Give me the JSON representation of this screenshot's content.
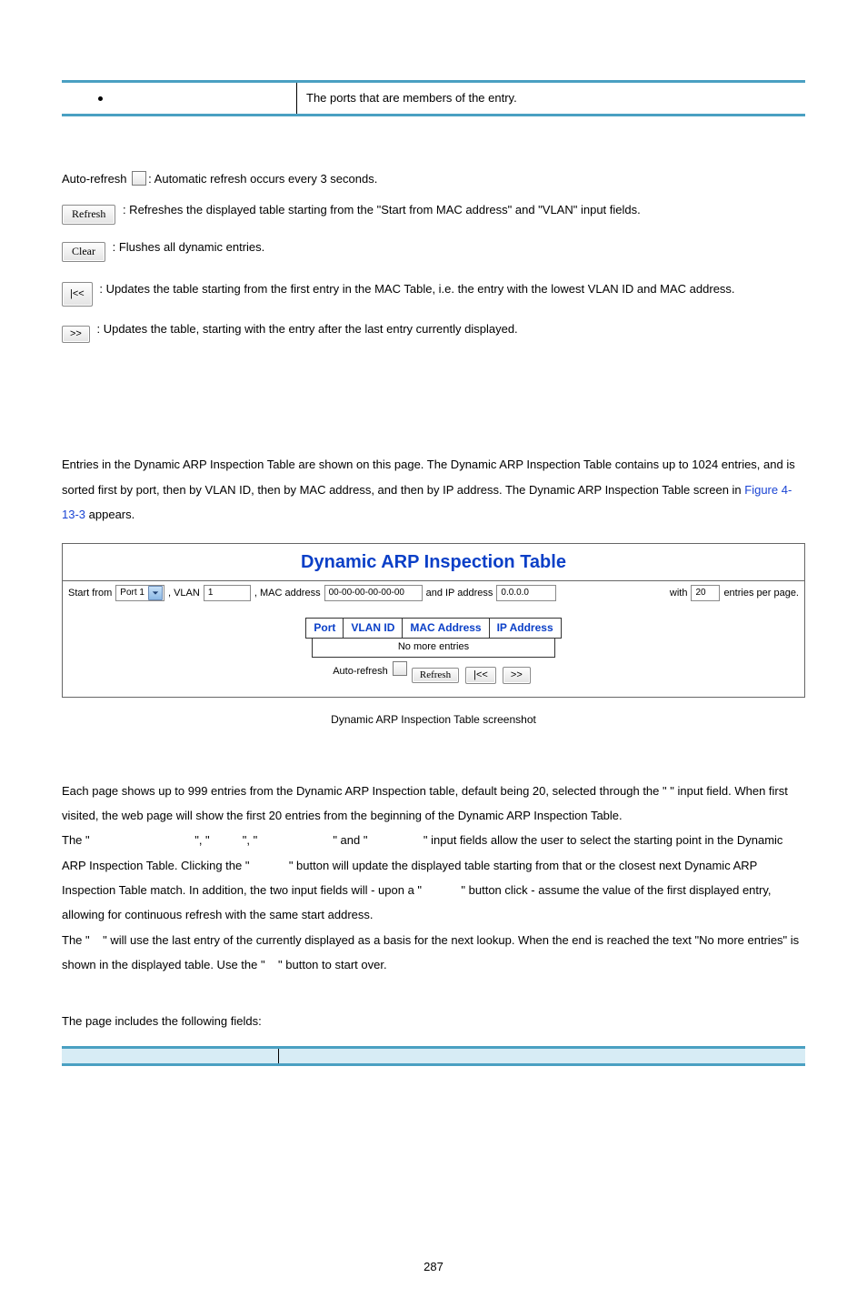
{
  "top_row": {
    "label": "",
    "desc": "The ports that are members of the entry."
  },
  "buttons": {
    "auto_refresh_prefix": "Auto-refresh ",
    "auto_refresh_suffix": ": Automatic refresh occurs every 3 seconds.",
    "refresh_label": "Refresh",
    "refresh_text": ": Refreshes the displayed table starting from the \"Start from MAC address\" and \"VLAN\" input fields.",
    "clear_label": "Clear",
    "clear_text": ": Flushes all dynamic entries.",
    "first_label": "|<<",
    "first_text": ": Updates the table starting from the first entry in the MAC Table, i.e. the entry with the lowest VLAN ID and MAC address.",
    "next_label": ">>",
    "next_text": ": Updates the table, starting with the entry after the last entry currently displayed."
  },
  "intro": {
    "line1": "Entries in the Dynamic ARP Inspection Table are shown on this page. The Dynamic ARP Inspection Table contains up to 1024 entries, and is sorted first by port, then by VLAN ID, then by MAC address, and then by IP address. The Dynamic ARP Inspection Table screen in ",
    "figref": "Figure 4-13-3",
    "line1_end": " appears."
  },
  "panel": {
    "title": "Dynamic ARP Inspection Table",
    "start_from": "Start from",
    "port_value": "Port 1",
    "vlan_prefix": ", VLAN",
    "vlan_value": "1",
    "mac_prefix": ", MAC address",
    "mac_value": "00-00-00-00-00-00",
    "ip_prefix": "and IP address",
    "ip_value": "0.0.0.0",
    "with_prefix": "with",
    "with_value": "20",
    "with_suffix": "entries per page.",
    "headers": [
      "Port",
      "VLAN ID",
      "MAC Address",
      "IP Address"
    ],
    "no_more": "No more entries",
    "auto_refresh_lbl": "Auto-refresh",
    "refresh_btn": "Refresh",
    "first_btn": "|<<",
    "next_btn": ">>"
  },
  "caption": "Dynamic ARP Inspection Table screenshot",
  "nav_para": {
    "p1_a": "Each page shows up to 999 entries from the Dynamic ARP Inspection table, default being 20, selected through the \"",
    "p1_b": "\" input field. When first visited, the web page will show the first 20 entries from the beginning of the Dynamic ARP Inspection Table.",
    "p2_a": "The \"",
    "p2_b": "\", \"",
    "p2_c": "\", \"",
    "p2_d": "\" and \"",
    "p2_e": "\" input fields allow the user to select the starting point in the Dynamic ARP Inspection Table. Clicking the \"",
    "p2_f": "\" button will update the displayed table starting from that or the closest next Dynamic ARP Inspection Table match. In addition, the two input fields will - upon a \"",
    "p2_g": "\" button click - assume the value of the first displayed entry, allowing for continuous refresh with the same start address.",
    "p3_a": "The \"",
    "p3_b": "\" will use the last entry of the currently displayed as a basis for the next lookup. When the end is reached the text \"No more entries\" is shown in the displayed table. Use the \"",
    "p3_c": "\" button to start over."
  },
  "fields_intro": "The page includes the following fields:",
  "fields_headers": {
    "c1": "",
    "c2": ""
  },
  "page_number": "287"
}
